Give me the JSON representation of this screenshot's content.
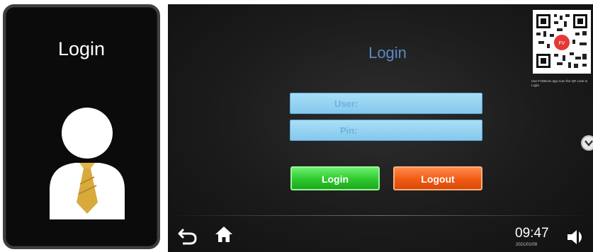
{
  "login_tile": {
    "title": "Login",
    "icon": "user-with-tie-icon"
  },
  "login_screen": {
    "title": "Login",
    "user_field_label": "User:",
    "pin_field_label": "Pin:",
    "login_button": "Login",
    "logout_button": "Logout",
    "qr_caption": "Use FVDBoss app scan the QR code to Login",
    "qr_icon": "qr-code-icon",
    "scroll_icon": "chevron-down-icon"
  },
  "footer": {
    "back_icon": "back-arrow-icon",
    "home_icon": "home-icon",
    "time": "09:47",
    "date": "2021/01/09",
    "volume_icon": "speaker-icon"
  },
  "colors": {
    "title_blue": "#5c87c9",
    "field_blue": "#a9def6",
    "login_green": "#2ec82e",
    "logout_orange": "#f05a14"
  }
}
